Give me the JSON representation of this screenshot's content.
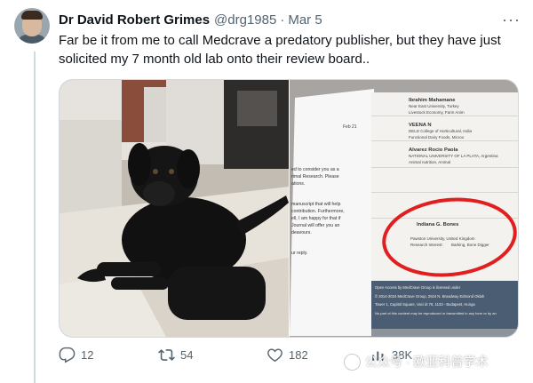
{
  "tweet": {
    "author": {
      "name": "Dr David Robert Grimes",
      "handle": "@drg1985",
      "separator": "·",
      "date": "Mar 5"
    },
    "text": "Far be it from me to call Medcrave a predatory publisher, but they have just solicited my 7 month old lab onto their review board..",
    "more_label": "···"
  },
  "media": {
    "screenshot": {
      "left_text_lines": [
        "ed to consider you as a",
        "rimal Research. Please",
        "ations.",
        "",
        "manuscript that will help",
        "contribution. Furthermore,",
        "ell, I am happy for that if",
        "Journal will offer you an",
        "deavours.",
        "",
        "ur reply."
      ],
      "reviewers": [
        {
          "name": "Ibrahim Mahamane",
          "affiliation": "Near East University, Turkey",
          "interest_label": "Research Interest:",
          "interest": "Livestock Economy, Farm Anim"
        },
        {
          "name": "VEENA N",
          "affiliation": "DELD College of Horticultural, India",
          "interest_label": "Research Interest:",
          "interest": "Functional Dairy Foods, Microo"
        },
        {
          "name": "Alvarez Rocio Paola",
          "affiliation": "NATIONAL UNIVERSITY OF LA PLATA, Argentina",
          "interest_label": "Research Interest:",
          "interest": "Animal nutrition, Animal"
        },
        {
          "name": "Indiana G. Bones",
          "affiliation": "Pawston University, United Kingdom",
          "interest_label": "Research Interest:",
          "interest": "Barking, Bone Digger"
        }
      ],
      "footer_lines": [
        "Open Access by MedCrave Group is licensed under",
        "© 2014-2024 MedCrave Group, 2524 N. Broadway Edmond Oklah",
        "Tower 1, Capitol Square, Vaci út 76, 1133 - Budapest, Hunga",
        "No part of this content may be reproduced or transmitted in any form or by an"
      ],
      "email_date": "Feb 21"
    }
  },
  "actions": {
    "replies": "12",
    "retweets": "54",
    "likes": "182",
    "views": "38K"
  },
  "watermark": {
    "text": "公众号 · 欧亚科普学术"
  },
  "colors": {
    "highlight_circle": "#e02020",
    "text_primary": "#0f1419",
    "text_secondary": "#536471"
  }
}
